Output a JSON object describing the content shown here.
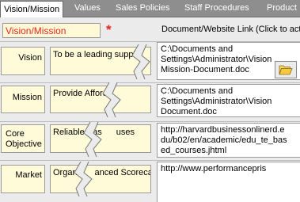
{
  "tabs": [
    {
      "label": "Vision/Mission",
      "active": true
    },
    {
      "label": "Values"
    },
    {
      "label": "Sales Policies"
    },
    {
      "label": "Staff Procedures"
    },
    {
      "label": "Product"
    }
  ],
  "header": {
    "title": "Vision/Mission",
    "required_marker": "*",
    "link_column_label": "Document/Website Link  (Click to acti"
  },
  "rows": [
    {
      "label": "Vision",
      "text": "To be a leading suppl…",
      "link_lines": [
        "C:\\Documents and",
        "Settings\\Administrator\\Vision",
        "Mission-Document.doc"
      ]
    },
    {
      "label": "Mission",
      "text": "Provide Afforda",
      "link_lines": [
        "C:\\Documents and",
        "Settings\\Administrator\\Vision",
        "Document.doc"
      ]
    },
    {
      "label_lines": [
        "Core",
        "Objective"
      ],
      "text": "Reliable Eas",
      "text_tail": "uses",
      "link_lines": [
        "http://harvardbusinessonlinerd.e",
        "du/b02/en/academic/edu_te_bas",
        "ed_courses.jhtml"
      ]
    },
    {
      "label": "Market",
      "text": "Organis",
      "text_tail": "anced Scorecard",
      "link_lines": [
        "http://www.performancepris"
      ]
    }
  ],
  "colors": {
    "tab_bar": "#8e8e8e",
    "label_bg": "#fffad8",
    "required_red": "#e5261f"
  },
  "icons": {
    "browse": "folder-open-icon"
  }
}
